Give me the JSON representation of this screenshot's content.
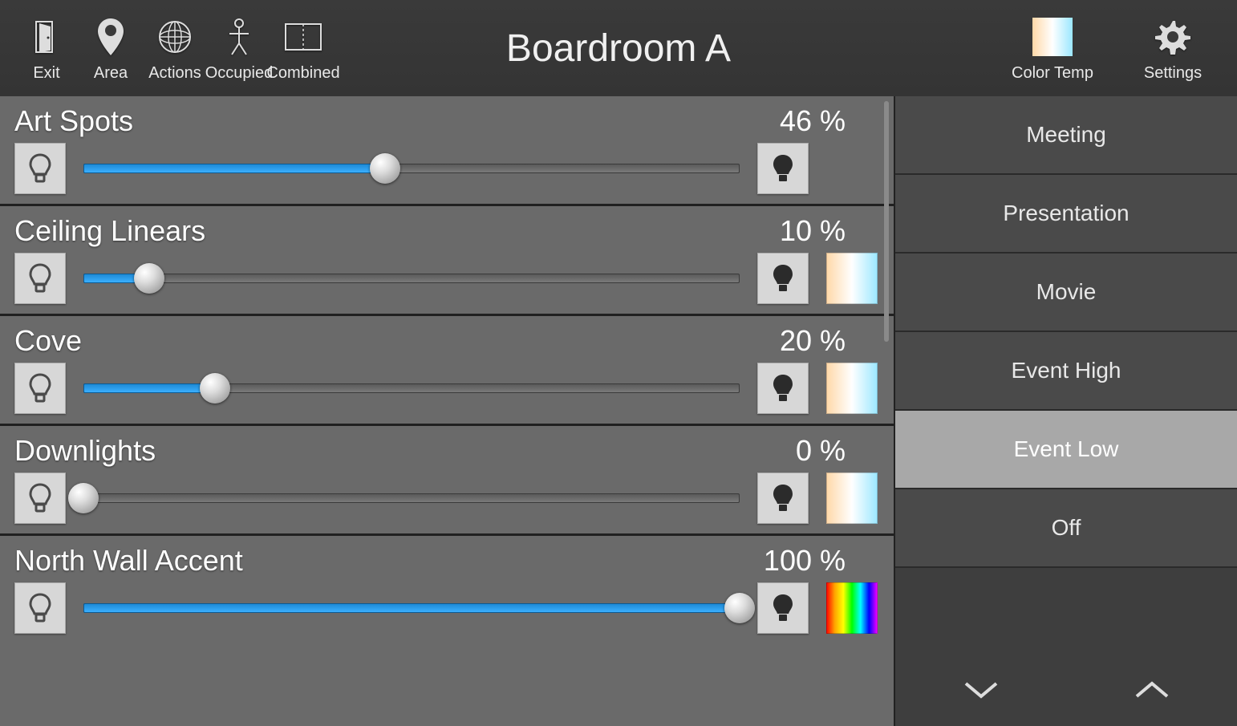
{
  "title": "Boardroom A",
  "topbar": {
    "left": [
      {
        "id": "exit",
        "label": "Exit"
      },
      {
        "id": "area",
        "label": "Area"
      },
      {
        "id": "actions",
        "label": "Actions"
      },
      {
        "id": "occupied",
        "label": "Occupied"
      },
      {
        "id": "combined",
        "label": "Combined"
      }
    ],
    "right": [
      {
        "id": "colortemp",
        "label": "Color Temp"
      },
      {
        "id": "settings",
        "label": "Settings"
      }
    ]
  },
  "channels": [
    {
      "name": "Art Spots",
      "pct": "46 %",
      "value": 46,
      "swatch": "none"
    },
    {
      "name": "Ceiling Linears",
      "pct": "10 %",
      "value": 10,
      "swatch": "ct"
    },
    {
      "name": "Cove",
      "pct": "20 %",
      "value": 20,
      "swatch": "ct"
    },
    {
      "name": "Downlights",
      "pct": "0 %",
      "value": 0,
      "swatch": "ct"
    },
    {
      "name": "North Wall Accent",
      "pct": "100 %",
      "value": 100,
      "swatch": "rgb"
    }
  ],
  "presets": [
    {
      "label": "Meeting",
      "active": false
    },
    {
      "label": "Presentation",
      "active": false
    },
    {
      "label": "Movie",
      "active": false
    },
    {
      "label": "Event High",
      "active": false
    },
    {
      "label": "Event Low",
      "active": true
    },
    {
      "label": "Off",
      "active": false
    }
  ]
}
